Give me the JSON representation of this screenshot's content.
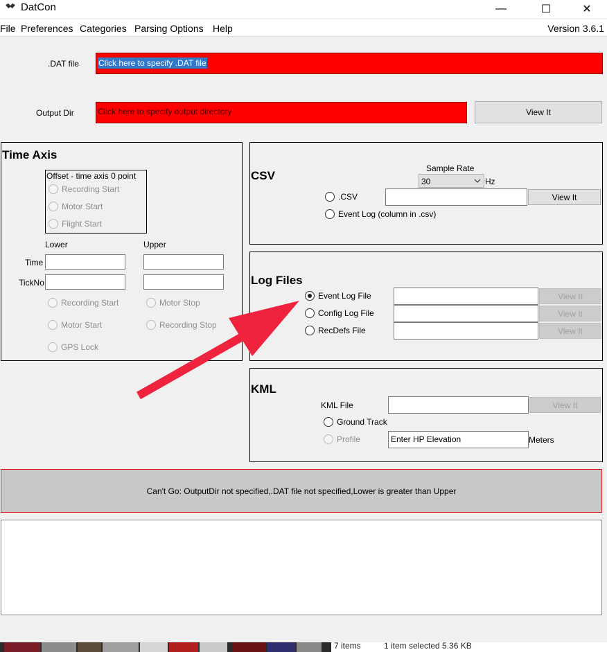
{
  "window": {
    "title": "DatCon",
    "minimize": "—",
    "maximize": "☐",
    "close": "✕"
  },
  "menu": {
    "items": [
      "File",
      "Preferences",
      "Categories",
      "Parsing Options",
      "Help"
    ],
    "version": "Version 3.6.1"
  },
  "dat_file": {
    "label": ".DAT file",
    "value": "Click here to specify .DAT file"
  },
  "output_dir": {
    "label": "Output Dir",
    "value": "Click here to specify output directory",
    "view_button": "View It"
  },
  "time_axis": {
    "title": "Time Axis",
    "offset": {
      "label": "Offset - time axis 0 point",
      "options": [
        "Recording Start",
        "Motor Start",
        "Flight Start"
      ]
    },
    "lower_label": "Lower",
    "upper_label": "Upper",
    "time_label": "Time",
    "tickno_label": "TickNo",
    "lower_options": [
      "Recording Start",
      "Motor Start",
      "GPS Lock"
    ],
    "upper_options": [
      "Motor Stop",
      "Recording Stop"
    ]
  },
  "csv": {
    "title": "CSV",
    "sample_rate_label": "Sample Rate",
    "sample_rate_value": "30",
    "hz_label": "Hz",
    "csv_option": ".CSV",
    "event_log_option": "Event Log (column in .csv)",
    "view_button": "View It"
  },
  "log_files": {
    "title": "Log Files",
    "items": [
      {
        "label": "Event Log File",
        "button": "View It",
        "checked": true
      },
      {
        "label": "Config Log File",
        "button": "View It",
        "checked": false
      },
      {
        "label": "RecDefs File",
        "button": "View It",
        "checked": false
      }
    ]
  },
  "kml": {
    "title": "KML",
    "file_label": "KML File",
    "view_button": "View It",
    "ground_track": "Ground Track",
    "profile": "Profile",
    "elevation_value": "Enter HP Elevation",
    "meters_label": "Meters"
  },
  "status": {
    "message": "Can't Go: OutputDir not specified,.DAT file not specified,Lower is greater than Upper"
  },
  "explorer_status": {
    "items": "7 items",
    "selected": "1 item selected  5.36 KB"
  },
  "colors": {
    "required_field": "#ff0000",
    "annotation_arrow": "#f0233f",
    "selection": "#3178c6"
  }
}
